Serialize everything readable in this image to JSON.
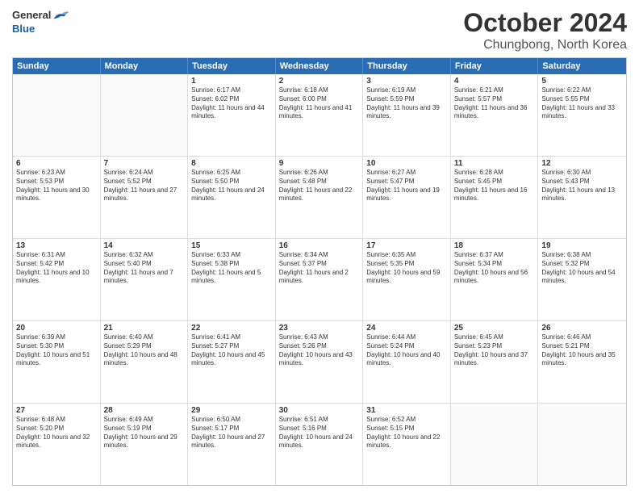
{
  "header": {
    "logo_general": "General",
    "logo_blue": "Blue",
    "title": "October 2024",
    "location": "Chungbong, North Korea"
  },
  "days_of_week": [
    "Sunday",
    "Monday",
    "Tuesday",
    "Wednesday",
    "Thursday",
    "Friday",
    "Saturday"
  ],
  "weeks": [
    [
      {
        "day": "",
        "info": ""
      },
      {
        "day": "",
        "info": ""
      },
      {
        "day": "1",
        "info": "Sunrise: 6:17 AM\nSunset: 6:02 PM\nDaylight: 11 hours and 44 minutes."
      },
      {
        "day": "2",
        "info": "Sunrise: 6:18 AM\nSunset: 6:00 PM\nDaylight: 11 hours and 41 minutes."
      },
      {
        "day": "3",
        "info": "Sunrise: 6:19 AM\nSunset: 5:59 PM\nDaylight: 11 hours and 39 minutes."
      },
      {
        "day": "4",
        "info": "Sunrise: 6:21 AM\nSunset: 5:57 PM\nDaylight: 11 hours and 36 minutes."
      },
      {
        "day": "5",
        "info": "Sunrise: 6:22 AM\nSunset: 5:55 PM\nDaylight: 11 hours and 33 minutes."
      }
    ],
    [
      {
        "day": "6",
        "info": "Sunrise: 6:23 AM\nSunset: 5:53 PM\nDaylight: 11 hours and 30 minutes."
      },
      {
        "day": "7",
        "info": "Sunrise: 6:24 AM\nSunset: 5:52 PM\nDaylight: 11 hours and 27 minutes."
      },
      {
        "day": "8",
        "info": "Sunrise: 6:25 AM\nSunset: 5:50 PM\nDaylight: 11 hours and 24 minutes."
      },
      {
        "day": "9",
        "info": "Sunrise: 6:26 AM\nSunset: 5:48 PM\nDaylight: 11 hours and 22 minutes."
      },
      {
        "day": "10",
        "info": "Sunrise: 6:27 AM\nSunset: 5:47 PM\nDaylight: 11 hours and 19 minutes."
      },
      {
        "day": "11",
        "info": "Sunrise: 6:28 AM\nSunset: 5:45 PM\nDaylight: 11 hours and 16 minutes."
      },
      {
        "day": "12",
        "info": "Sunrise: 6:30 AM\nSunset: 5:43 PM\nDaylight: 11 hours and 13 minutes."
      }
    ],
    [
      {
        "day": "13",
        "info": "Sunrise: 6:31 AM\nSunset: 5:42 PM\nDaylight: 11 hours and 10 minutes."
      },
      {
        "day": "14",
        "info": "Sunrise: 6:32 AM\nSunset: 5:40 PM\nDaylight: 11 hours and 7 minutes."
      },
      {
        "day": "15",
        "info": "Sunrise: 6:33 AM\nSunset: 5:38 PM\nDaylight: 11 hours and 5 minutes."
      },
      {
        "day": "16",
        "info": "Sunrise: 6:34 AM\nSunset: 5:37 PM\nDaylight: 11 hours and 2 minutes."
      },
      {
        "day": "17",
        "info": "Sunrise: 6:35 AM\nSunset: 5:35 PM\nDaylight: 10 hours and 59 minutes."
      },
      {
        "day": "18",
        "info": "Sunrise: 6:37 AM\nSunset: 5:34 PM\nDaylight: 10 hours and 56 minutes."
      },
      {
        "day": "19",
        "info": "Sunrise: 6:38 AM\nSunset: 5:32 PM\nDaylight: 10 hours and 54 minutes."
      }
    ],
    [
      {
        "day": "20",
        "info": "Sunrise: 6:39 AM\nSunset: 5:30 PM\nDaylight: 10 hours and 51 minutes."
      },
      {
        "day": "21",
        "info": "Sunrise: 6:40 AM\nSunset: 5:29 PM\nDaylight: 10 hours and 48 minutes."
      },
      {
        "day": "22",
        "info": "Sunrise: 6:41 AM\nSunset: 5:27 PM\nDaylight: 10 hours and 45 minutes."
      },
      {
        "day": "23",
        "info": "Sunrise: 6:43 AM\nSunset: 5:26 PM\nDaylight: 10 hours and 43 minutes."
      },
      {
        "day": "24",
        "info": "Sunrise: 6:44 AM\nSunset: 5:24 PM\nDaylight: 10 hours and 40 minutes."
      },
      {
        "day": "25",
        "info": "Sunrise: 6:45 AM\nSunset: 5:23 PM\nDaylight: 10 hours and 37 minutes."
      },
      {
        "day": "26",
        "info": "Sunrise: 6:46 AM\nSunset: 5:21 PM\nDaylight: 10 hours and 35 minutes."
      }
    ],
    [
      {
        "day": "27",
        "info": "Sunrise: 6:48 AM\nSunset: 5:20 PM\nDaylight: 10 hours and 32 minutes."
      },
      {
        "day": "28",
        "info": "Sunrise: 6:49 AM\nSunset: 5:19 PM\nDaylight: 10 hours and 29 minutes."
      },
      {
        "day": "29",
        "info": "Sunrise: 6:50 AM\nSunset: 5:17 PM\nDaylight: 10 hours and 27 minutes."
      },
      {
        "day": "30",
        "info": "Sunrise: 6:51 AM\nSunset: 5:16 PM\nDaylight: 10 hours and 24 minutes."
      },
      {
        "day": "31",
        "info": "Sunrise: 6:52 AM\nSunset: 5:15 PM\nDaylight: 10 hours and 22 minutes."
      },
      {
        "day": "",
        "info": ""
      },
      {
        "day": "",
        "info": ""
      }
    ]
  ]
}
